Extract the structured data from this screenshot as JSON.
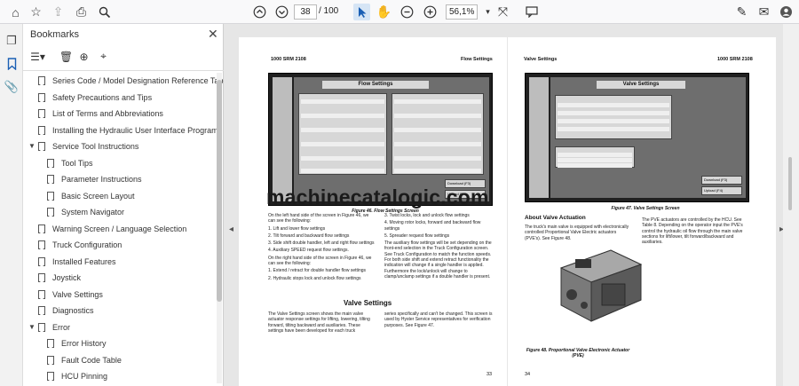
{
  "toolbar": {
    "current_page": "38",
    "total_pages": "/ 100",
    "zoom": "56,1%"
  },
  "bookmarks": {
    "title": "Bookmarks",
    "items": [
      {
        "label": "Series Code / Model Designation Reference Table"
      },
      {
        "label": "Safety Precautions and Tips"
      },
      {
        "label": "List of Terms and Abbreviations"
      },
      {
        "label": "Installing the Hydraulic User Interface Program"
      },
      {
        "label": "Service Tool Instructions"
      },
      {
        "label": "Tool Tips"
      },
      {
        "label": "Parameter Instructions"
      },
      {
        "label": "Basic Screen Layout"
      },
      {
        "label": "System Navigator"
      },
      {
        "label": "Warning Screen / Language Selection"
      },
      {
        "label": "Truck Configuration"
      },
      {
        "label": "Installed Features"
      },
      {
        "label": "Joystick"
      },
      {
        "label": "Valve Settings"
      },
      {
        "label": "Diagnostics"
      },
      {
        "label": "Error"
      },
      {
        "label": "Error History"
      },
      {
        "label": "Fault Code Table"
      },
      {
        "label": "HCU Pinning"
      }
    ]
  },
  "left_page": {
    "header_left": "1000 SRM 2108",
    "header_right": "Flow Settings",
    "screen_title": "Flow Settings",
    "screen_buttons": [
      "Download (F3)",
      "Upload (F4)"
    ],
    "fig_caption": "Figure 46. Flow Settings Screen",
    "col1": [
      "On the left hand side of the screen in Figure 46, we can see the following:",
      "1.   Lift and lower flow settings",
      "2.   Tilt forward and backward flow settings",
      "3.   Side shift double handler, left and right flow settings",
      "4.   Auxiliary SPEED request flow settings.",
      "On the right hand side of the screen in Figure 46, we can see the following:",
      "1.   Extend / retract for double handler flow settings",
      "2.   Hydraulic stops lock and unlock flow settings"
    ],
    "col2": [
      "3.   Twist locks, lock and unlock flow settings",
      "4.   Moving rotor locks, forward and backward flow settings",
      "5.   Spreader request flow settings",
      "The auxiliary flow settings will be set depending on the front-end selection in the Truck Configuration screen. See Truck Configuration to match the function speeds. For both side shift and extend retract functionality the indication will change if a single handler is applied. Furthermore the lock/unlock will change to clamp/unclamp settings if a double handler is present."
    ],
    "section_title": "Valve Settings",
    "section_col1": "The Valve Settings screen shows the main valve actuator response settings for lifting, lowering, tilting forward, tilting backward and auxiliaries. These settings have been developed for each truck",
    "section_col2": "series specifically and can't be changed. This screen is used by Hyster Service representatives for verification purposes. See Figure 47.",
    "page_number": "33"
  },
  "right_page": {
    "header_left": "Valve Settings",
    "header_right": "1000 SRM 2108",
    "screen_title": "Valve Settings",
    "screen_buttons": [
      "Download (F3)",
      "Upload (F4)"
    ],
    "fig_caption": "Figure 47. Valve Settings Screen",
    "section_title": "About Valve Actuation",
    "col1": "The truck's main valve is equipped with electronically controlled Proportional Valve Electric actuators (PVE's). See Figure 48.",
    "col2": "The PVE actuators are controlled by the HCU. See Table 8. Depending on the operator input the PVE's control the hydraulic oil flow through the main valve sections for lift/lower, tilt forward/backward and auxiliaries.",
    "fig48_caption": "Figure 48. Proportional Valve Electronic Actuator (PVE)",
    "page_number": "34"
  },
  "watermark": "machinecatalogic.com"
}
